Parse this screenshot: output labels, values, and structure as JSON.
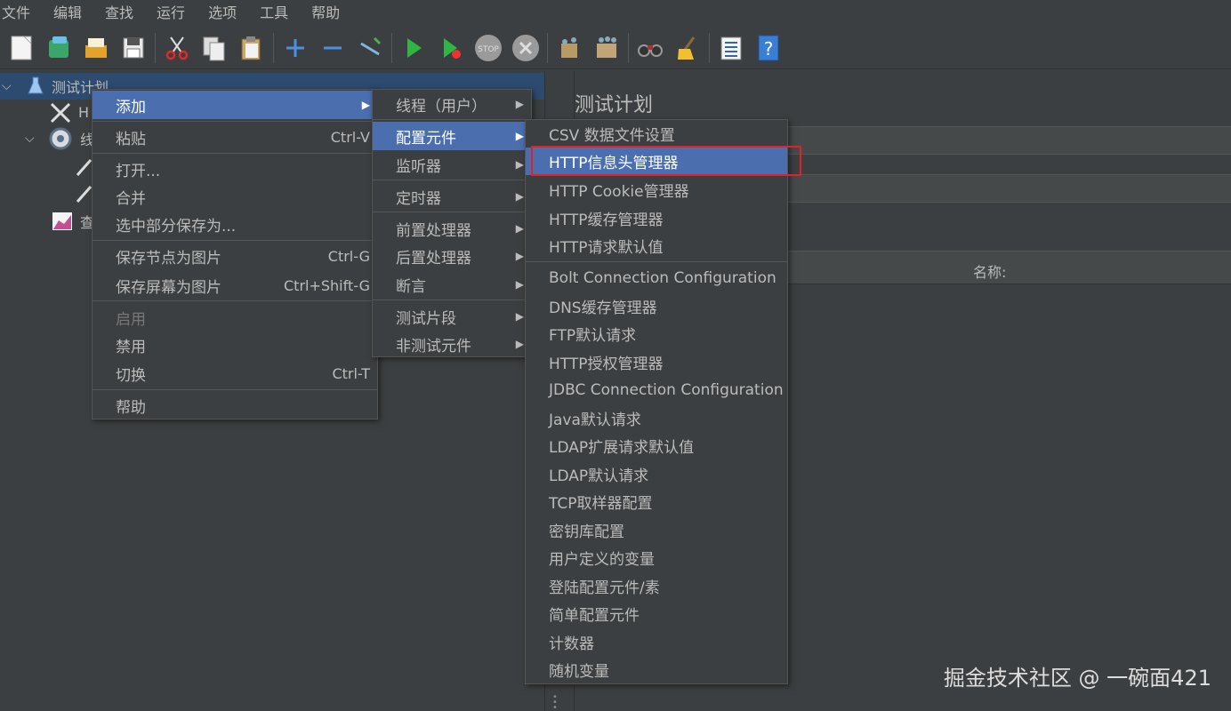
{
  "menubar": [
    "文件",
    "编辑",
    "查找",
    "运行",
    "选项",
    "工具",
    "帮助"
  ],
  "toolbar": {
    "icons": [
      "new-icon",
      "templates-icon",
      "open-icon",
      "save-icon",
      "cut-icon",
      "copy-icon",
      "paste-icon",
      "expand-icon",
      "collapse-icon",
      "toggle-icon",
      "start-icon",
      "start-no-pause-icon",
      "stop-icon",
      "shutdown-icon",
      "clear-icon",
      "clear-all-icon",
      "search-icon",
      "reset-search-icon",
      "function-helper-icon",
      "help-icon"
    ]
  },
  "tree": {
    "root": "测试计划",
    "child1": "H",
    "child2": "线",
    "child3": "查"
  },
  "right_panel": {
    "title": "测试计划",
    "table_header": "名称:"
  },
  "context_menu": {
    "add": "添加",
    "paste": "粘贴",
    "paste_shortcut": "Ctrl-V",
    "open": "打开...",
    "merge": "合并",
    "save_selection": "选中部分保存为...",
    "save_node_image": "保存节点为图片",
    "save_node_image_shortcut": "Ctrl-G",
    "save_screen_image": "保存屏幕为图片",
    "save_screen_image_shortcut": "Ctrl+Shift-G",
    "enable": "启用",
    "disable": "禁用",
    "toggle": "切换",
    "toggle_shortcut": "Ctrl-T",
    "help": "帮助"
  },
  "add_menu": {
    "threads": "线程（用户）",
    "config": "配置元件",
    "listener": "监听器",
    "timer": "定时器",
    "pre": "前置处理器",
    "post": "后置处理器",
    "assertion": "断言",
    "fragment": "测试片段",
    "non_test": "非测试元件"
  },
  "config_menu": {
    "items": [
      "CSV 数据文件设置",
      "HTTP信息头管理器",
      "HTTP Cookie管理器",
      "HTTP缓存管理器",
      "HTTP请求默认值",
      "Bolt Connection Configuration",
      "DNS缓存管理器",
      "FTP默认请求",
      "HTTP授权管理器",
      "JDBC Connection Configuration",
      "Java默认请求",
      "LDAP扩展请求默认值",
      "LDAP默认请求",
      "TCP取样器配置",
      "密钥库配置",
      "用户定义的变量",
      "登陆配置元件/素",
      "简单配置元件",
      "计数器",
      "随机变量"
    ]
  },
  "watermark": "掘金技术社区 @ 一碗面421",
  "colors": {
    "background": "#3c3f41",
    "menu_active": "#4b6eaf",
    "tree_selected": "#2d4b6e",
    "highlight_box": "#e0202a"
  }
}
